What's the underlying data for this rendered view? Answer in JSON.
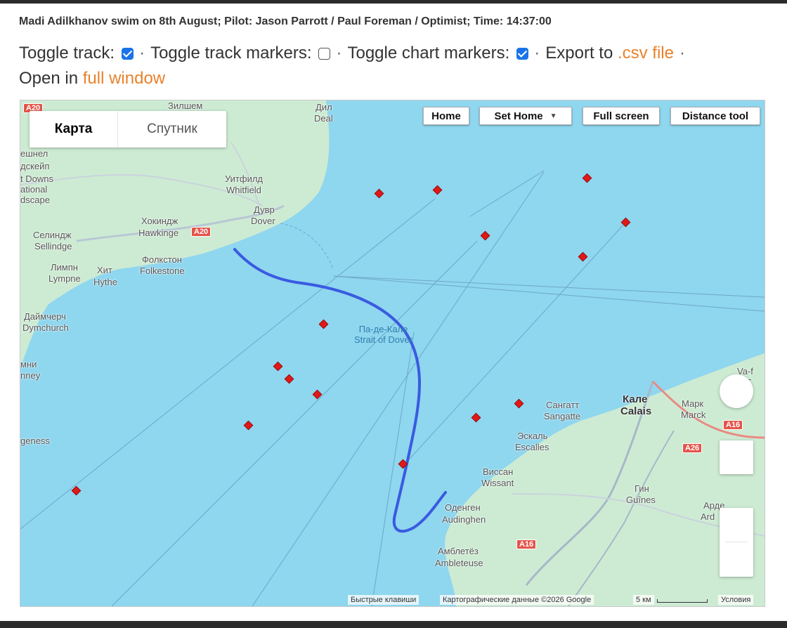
{
  "title": "Madi Adilkhanov swim on 8th August; Pilot: Jason Parrott / Paul Foreman / Optimist; Time: 14:37:00",
  "controls": {
    "toggle_track": {
      "label": "Toggle track:",
      "checked": true
    },
    "toggle_track_markers": {
      "label": "Toggle track markers:",
      "checked": false
    },
    "toggle_chart_markers": {
      "label": "Toggle chart markers:",
      "checked": true
    },
    "separator": "·",
    "export_prefix": "Export to",
    "export_link": ".csv file",
    "open_prefix": "Open in",
    "open_link": "full window"
  },
  "map": {
    "map_type": {
      "map": "Карта",
      "satellite": "Спутник",
      "selected": "map"
    },
    "buttons": {
      "home": "Home",
      "set_home": "Set Home",
      "full_screen": "Full screen",
      "distance_tool": "Distance tool"
    },
    "colors": {
      "sea": "#8fd6ef",
      "land": "#cdebd3",
      "track": "#3a5be0",
      "marker": "#e01818"
    },
    "labels": {
      "zilsham": "Зилшем",
      "dil": "Дил",
      "deal": "Deal",
      "shnel": "ешнел",
      "dskeyp": "дскейп",
      "tdowns": "t Downs",
      "ational": "ational",
      "dscape": "dscape",
      "uitfild": "Уитфилд",
      "whitfield": "Whitfield",
      "duvr": "Дувр",
      "dover": "Dover",
      "hokindzh": "Хокиндж",
      "hawkinge": "Hawkinge",
      "selindzh": "Селиндж",
      "sellindge": "Sellindge",
      "folkston": "Фолкстон",
      "folkestone": "Folkestone",
      "limpn": "Лимпн",
      "lympne": "Lympne",
      "khit": "Хит",
      "hythe": "Hythe",
      "daymcherch": "Даймчерч",
      "dymchurch": "Dymchurch",
      "mni": "мни",
      "nney": "nney",
      "geness": "geness",
      "strait_ru": "Па-де-Кале",
      "strait_en": "Strait of Dover",
      "sangatt": "Сангатт",
      "sangatte": "Sangatte",
      "kale": "Кале",
      "calais": "Calais",
      "mark": "Марк",
      "marck": "Marck",
      "vaf": "Va-f",
      "frf": "-F",
      "eskal": "Эскаль",
      "escalles": "Escalles",
      "vissan": "Виссан",
      "wissant": "Wissant",
      "gin": "Гин",
      "guines": "Guînes",
      "arr": "Арде",
      "ard": "Ard",
      "odengen": "Оденген",
      "audinghen": "Audinghen",
      "ambletez": "Амблетёз",
      "ambleteuse": "Ambleteuse"
    },
    "road_shields": {
      "a20": "A20",
      "a16a": "A16",
      "a26": "A26",
      "a16b": "A16",
      "a16c": "A16",
      "a20b": "A20"
    },
    "attribution": {
      "shortcuts": "Быстрые клавиши",
      "data": "Картографические данные ©2026 Google",
      "scale": "5 км",
      "terms": "Условия"
    },
    "icons": [
      "map-type-control",
      "fullscreen-control-icon",
      "pegman-icon",
      "zoom-in-icon",
      "zoom-out-icon",
      "chart-marker-icon"
    ],
    "marker_count": 17
  }
}
